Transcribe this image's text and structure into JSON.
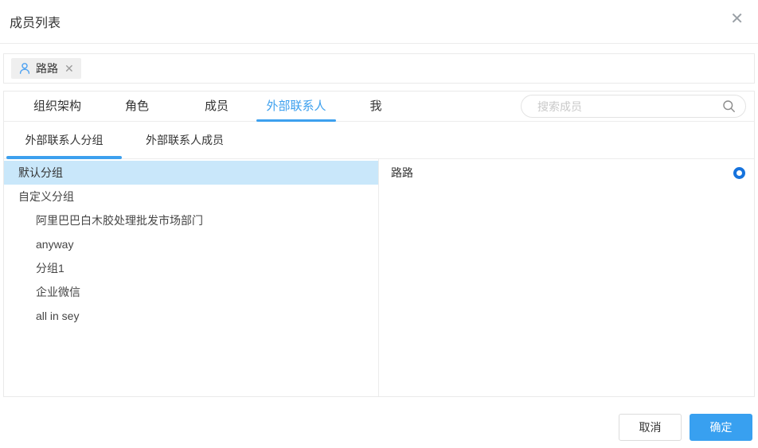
{
  "dialog": {
    "title": "成员列表"
  },
  "icons": {
    "close_glyph": "✕",
    "chip_remove_glyph": "✕"
  },
  "selected_members": [
    {
      "name": "路路"
    }
  ],
  "tabs": [
    {
      "label": "组织架构",
      "active": false
    },
    {
      "label": "角色",
      "active": false
    },
    {
      "label": "成员",
      "active": false
    },
    {
      "label": "外部联系人",
      "active": true
    },
    {
      "label": "我",
      "active": false
    }
  ],
  "search": {
    "placeholder": "搜索成员"
  },
  "subtabs": [
    {
      "label": "外部联系人分组",
      "active": true
    },
    {
      "label": "外部联系人成员",
      "active": false
    }
  ],
  "groups": [
    {
      "label": "默认分组",
      "level": 0,
      "selected": true
    },
    {
      "label": "自定义分组",
      "level": 0,
      "selected": false
    },
    {
      "label": "阿里巴巴白木胶处理批发市场部门",
      "level": 1,
      "selected": false
    },
    {
      "label": "anyway",
      "level": 1,
      "selected": false
    },
    {
      "label": "分组1",
      "level": 1,
      "selected": false
    },
    {
      "label": "企业微信",
      "level": 1,
      "selected": false
    },
    {
      "label": "all in sey",
      "level": 1,
      "selected": false
    }
  ],
  "members": [
    {
      "name": "路路",
      "selected": true
    }
  ],
  "footer": {
    "cancel_label": "取消",
    "confirm_label": "确定"
  },
  "colors": {
    "accent": "#3DA0EE",
    "radio": "#1673DD",
    "selected_row_bg": "#C9E7FA",
    "confirm_bg": "#38A0F0"
  }
}
